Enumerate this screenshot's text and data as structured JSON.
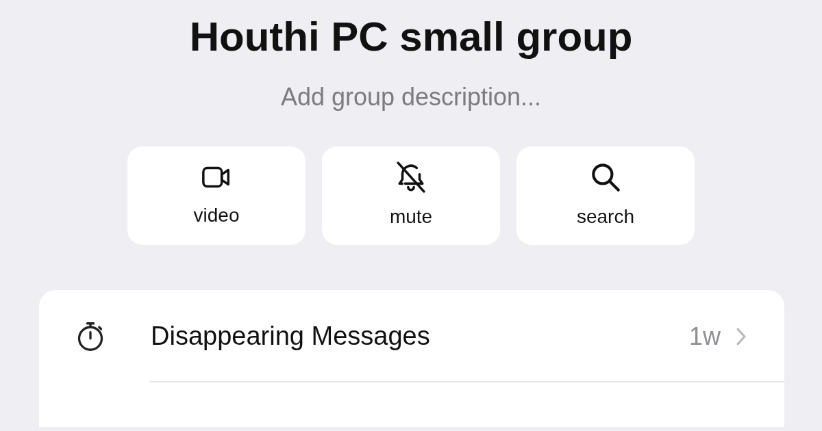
{
  "title": "Houthi PC small group",
  "description": {
    "placeholder": "Add group description..."
  },
  "actions": [
    {
      "kind": "video",
      "label": "video"
    },
    {
      "kind": "mute",
      "label": "mute"
    },
    {
      "kind": "search",
      "label": "search"
    }
  ],
  "settings": [
    {
      "kind": "timer",
      "label": "Disappearing Messages",
      "value": "1w"
    }
  ]
}
